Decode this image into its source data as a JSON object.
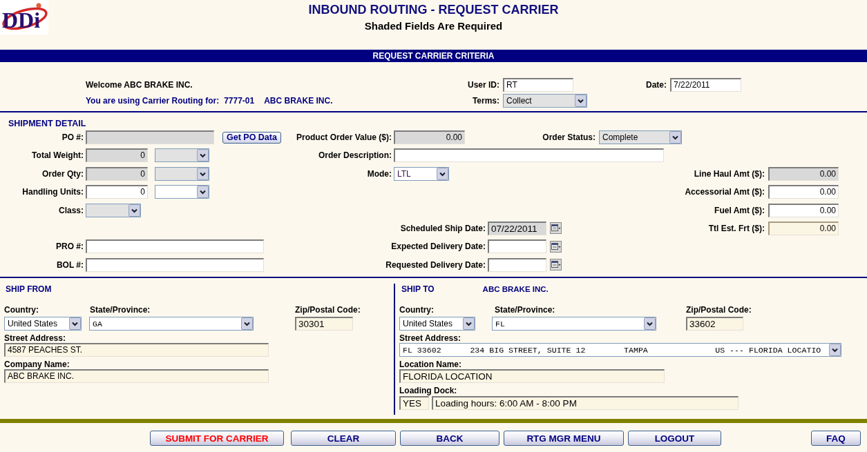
{
  "header": {
    "logo": "DDi",
    "title": "INBOUND ROUTING - REQUEST CARRIER",
    "subtitle": "Shaded Fields Are Required"
  },
  "criteria": {
    "heading": "REQUEST CARRIER CRITERIA",
    "welcome": "Welcome ABC BRAKE INC.",
    "routing_label": "You are using Carrier Routing for:",
    "account": "7777-01",
    "company": "ABC BRAKE INC.",
    "user_id": {
      "label": "User ID:",
      "value": "RT"
    },
    "date": {
      "label": "Date:",
      "value": "7/22/2011"
    },
    "terms": {
      "label": "Terms:",
      "value": "Collect",
      "shaded": true
    }
  },
  "shipment_detail": {
    "heading": "SHIPMENT DETAIL",
    "po_number": {
      "label": "PO #:",
      "shaded": true
    },
    "get_po_button": "Get PO Data",
    "total_weight": {
      "label": "Total Weight:",
      "value": "0",
      "shaded": true,
      "unit": {
        "shaded": true
      }
    },
    "order_qty": {
      "label": "Order Qty:",
      "value": "0",
      "shaded": true,
      "unit": {
        "shaded": true
      }
    },
    "handling_units": {
      "label": "Handling Units:",
      "value": "0",
      "shaded": false,
      "unit": {
        "shaded": false
      }
    },
    "class": {
      "label": "Class:",
      "shaded": true
    },
    "pro_number": {
      "label": "PRO #:",
      "shaded": false
    },
    "bol_number": {
      "label": "BOL #:",
      "shaded": false
    },
    "product_order_value": {
      "label": "Product Order Value ($):",
      "value": "0.00",
      "shaded": true
    },
    "order_status": {
      "label": "Order Status:",
      "value": "Complete",
      "shaded": true
    },
    "order_description": {
      "label": "Order Description:",
      "shaded": false
    },
    "mode": {
      "label": "Mode:",
      "value": "LTL",
      "shaded": false
    },
    "dates": [
      {
        "label": "Scheduled Ship Date:",
        "value": "07/22/2011",
        "shaded": true
      },
      {
        "label": "Expected Delivery Date:",
        "shaded": false
      },
      {
        "label": "Requested Delivery Date:",
        "shaded": false
      }
    ],
    "charges": [
      {
        "label": "Line Haul Amt ($):",
        "value": "0.00",
        "shaded": true,
        "readonly": false
      },
      {
        "label": "Accessorial Amt ($):",
        "value": "0.00",
        "shaded": false,
        "readonly": false
      },
      {
        "label": "Fuel Amt ($):",
        "value": "0.00",
        "shaded": false,
        "readonly": false
      },
      {
        "label": "Ttl Est. Frt ($):",
        "value": "0.00",
        "shaded": false,
        "readonly": true
      }
    ]
  },
  "ship_from": {
    "heading": "SHIP FROM",
    "country": {
      "label": "Country:",
      "value": "United States"
    },
    "state": {
      "label": "State/Province:",
      "value": "GA"
    },
    "zip": {
      "label": "Zip/Postal Code:",
      "value": "30301"
    },
    "street": {
      "label": "Street Address:",
      "value": "4587 PEACHES ST."
    },
    "company_name": {
      "label": "Company Name:",
      "value": "ABC BRAKE INC."
    }
  },
  "ship_to": {
    "heading": "SHIP TO",
    "company": "ABC BRAKE INC.",
    "country": {
      "label": "Country:",
      "value": "United States"
    },
    "state": {
      "label": "State/Province:",
      "value": "FL"
    },
    "zip": {
      "label": "Zip/Postal Code:",
      "value": "33602"
    },
    "street": {
      "label": "Street Address:",
      "value": "FL 33602      234 BIG STREET, SUITE 12        TAMPA              US --- FLORIDA LOCATIO"
    },
    "location_name": {
      "label": "Location Name:",
      "value": "FLORIDA LOCATION"
    },
    "loading_dock": {
      "label": "Loading Dock:",
      "value": "YES",
      "hours": "Loading hours: 6:00 AM - 8:00 PM"
    }
  },
  "footer": {
    "buttons": [
      {
        "label": "SUBMIT FOR CARRIER",
        "color": "#ff0000"
      },
      {
        "label": "CLEAR",
        "color": "#000080"
      },
      {
        "label": "BACK",
        "color": "#000080"
      },
      {
        "label": "RTG MGR MENU",
        "color": "#000080"
      },
      {
        "label": "LOGOUT",
        "color": "#000080"
      },
      {
        "label": "FAQ",
        "color": "#000080"
      }
    ]
  }
}
